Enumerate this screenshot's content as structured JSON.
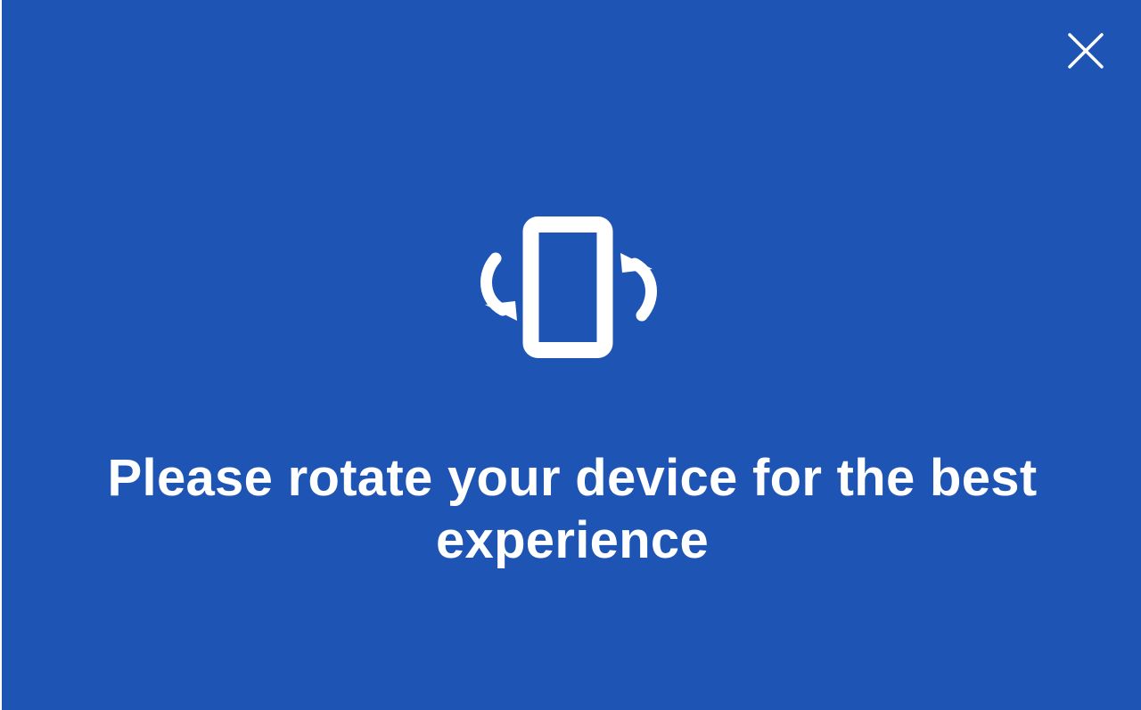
{
  "overlay": {
    "background_color": "#1e55b5",
    "foreground_color": "#ffffff",
    "close_icon": "close-icon",
    "rotate_icon": "rotate-device-icon",
    "message_lines": [
      "Please rotate your device for the best",
      "experience"
    ]
  }
}
